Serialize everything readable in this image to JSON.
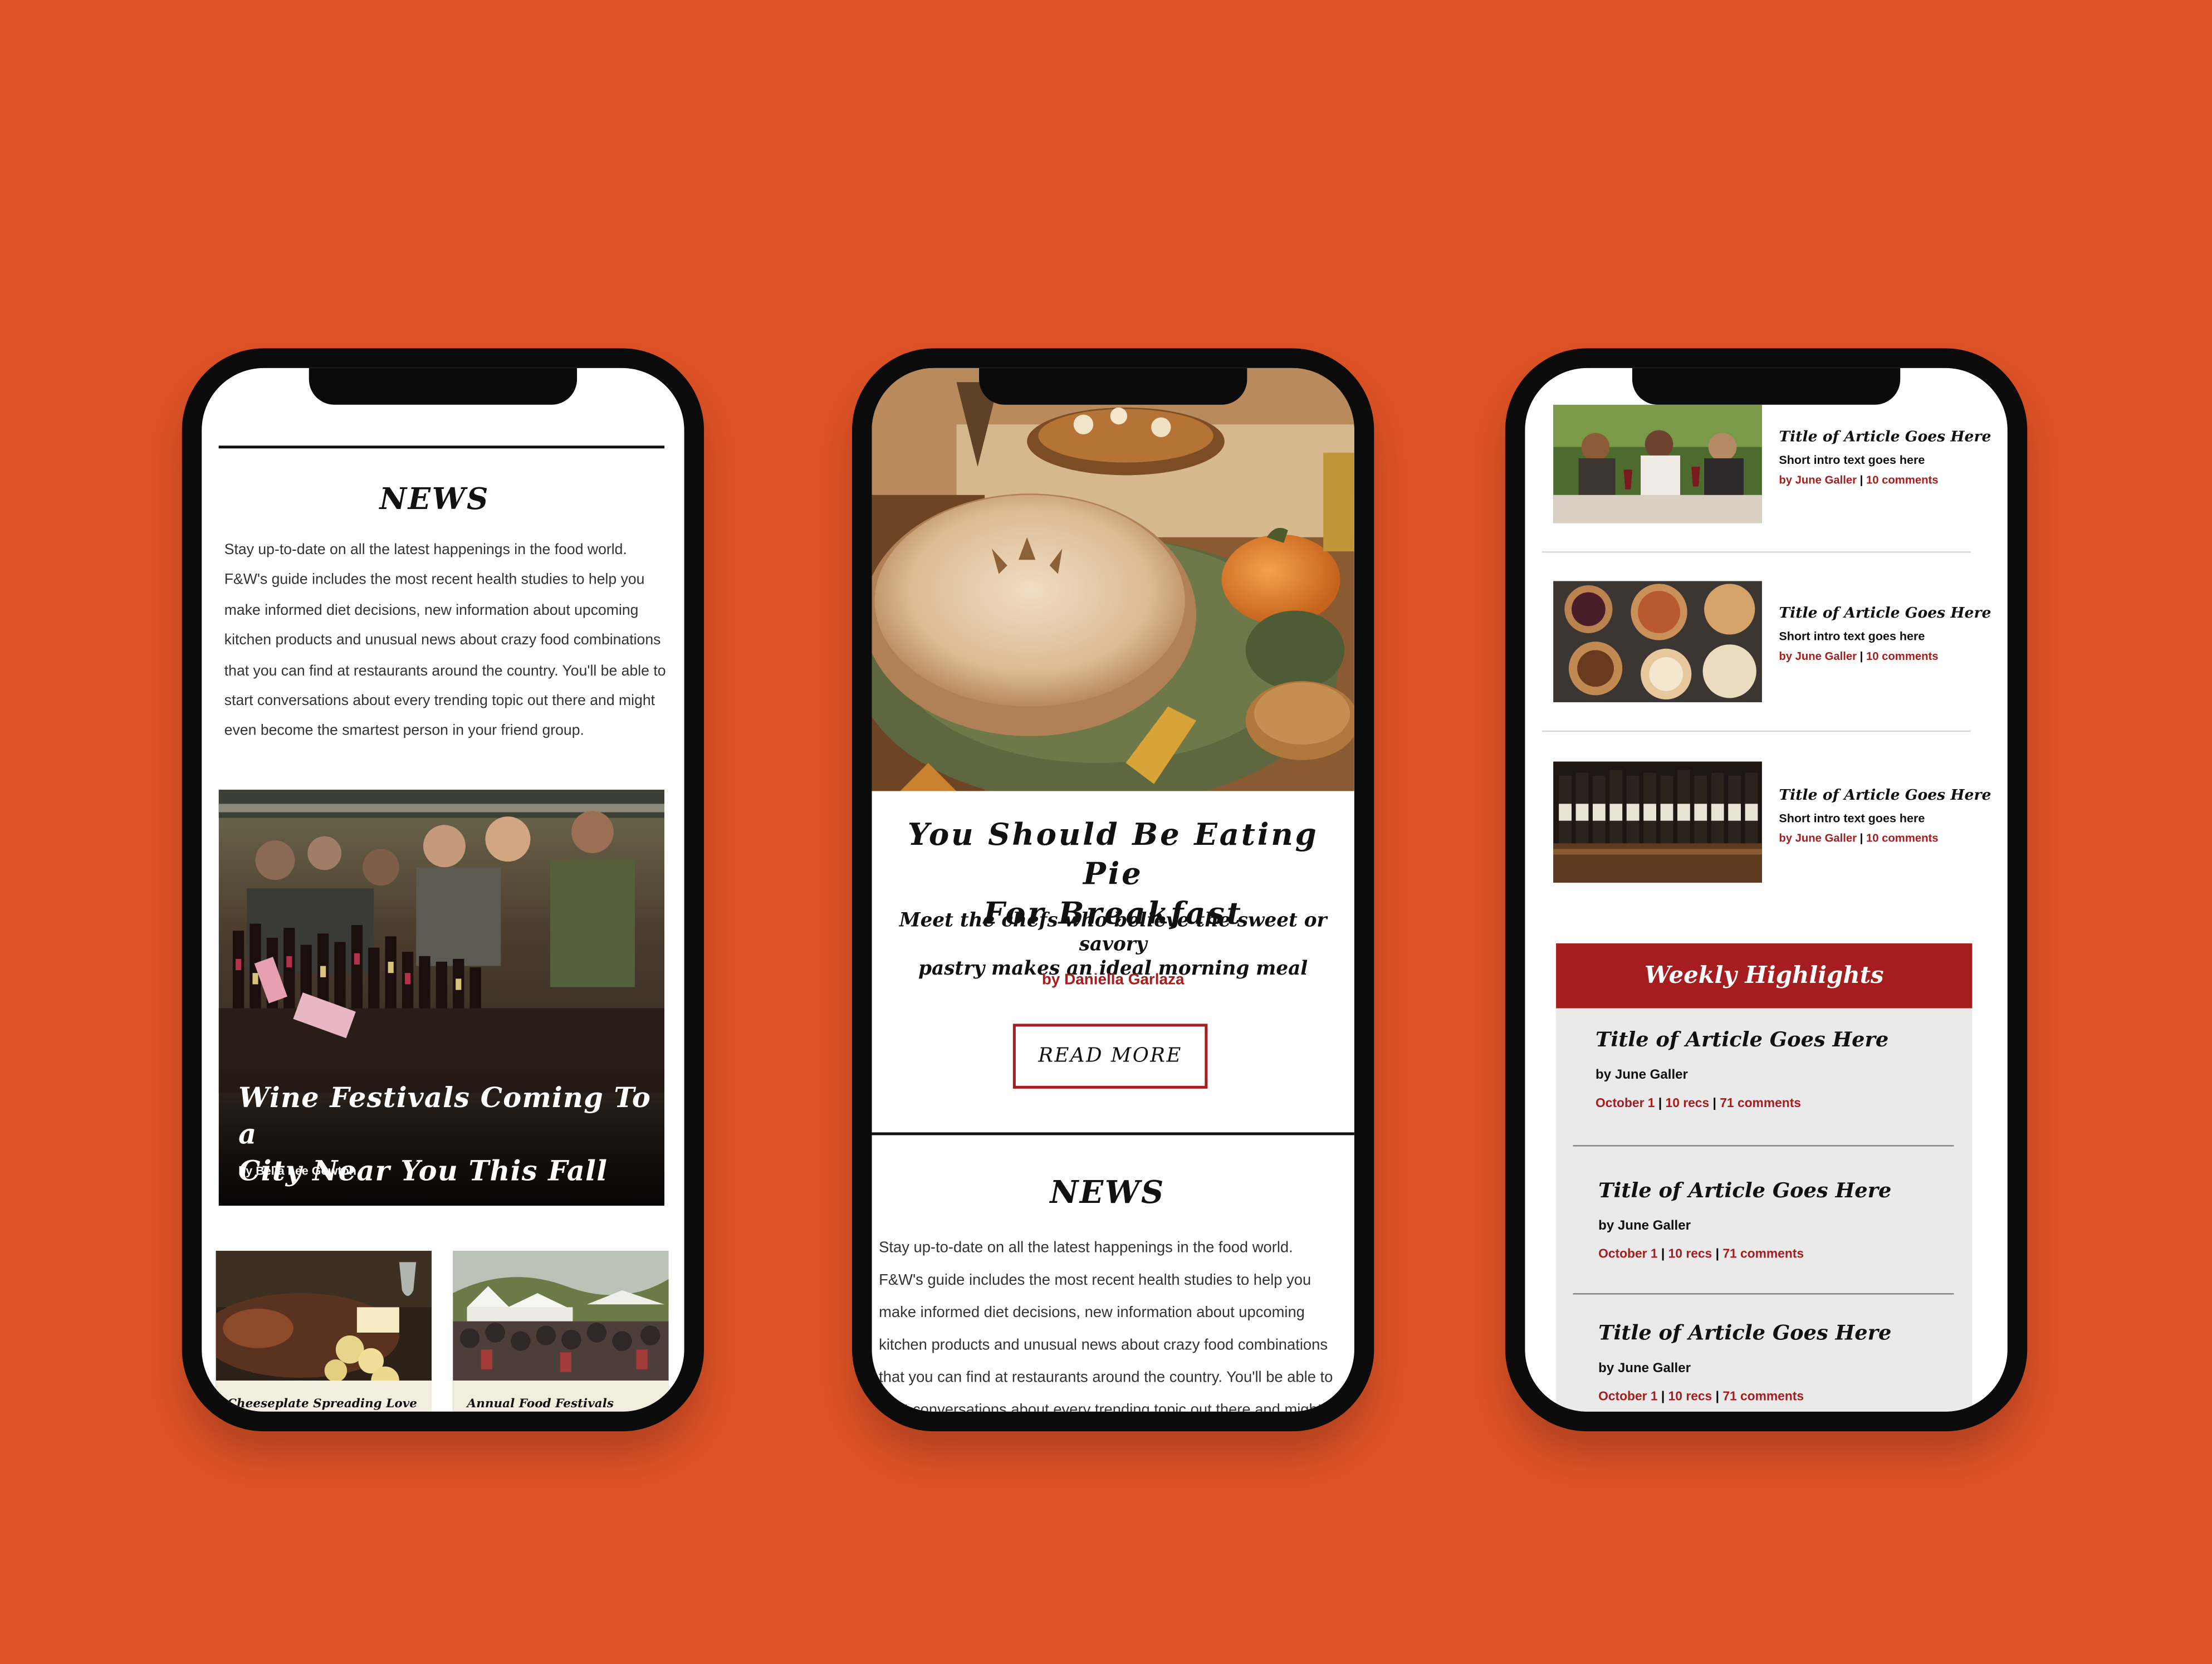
{
  "colors": {
    "background": "#de5227",
    "accent_red": "#a61d1f",
    "phone_frame": "#0b0b0b"
  },
  "phone1": {
    "section_title": "NEWS",
    "intro_lines": [
      "Stay up-to-date on all the latest happenings in the food world.",
      "F&W's guide includes the most recent health studies to help you",
      "make informed diet decisions, new information about upcoming",
      "kitchen products and unusual news about crazy food combinations",
      "that you can find at restaurants around the country. You'll be able to",
      "start conversations about every trending topic out there and might",
      "even become the smartest person in your friend group."
    ],
    "feature": {
      "title_line1": "Wine Festivals Coming To a",
      "title_line2": "City Near You This Fall",
      "byline": "by Bella  Lee Gowton"
    },
    "cards": [
      {
        "caption": "Cheeseplate Spreading Love"
      },
      {
        "caption": "Annual Food Festivals"
      }
    ]
  },
  "phone2": {
    "hero": {
      "title_line1": "You Should Be Eating Pie",
      "title_line2": "For Breakfast",
      "subtitle_line1": "Meet the chefs who believe the sweet or savory",
      "subtitle_line2": "pastry makes an ideal morning meal",
      "byline": "by Daniella Garlaza",
      "button_label": "READ  MORE"
    },
    "section_title": "NEWS",
    "intro_lines": [
      "Stay up-to-date on all the latest happenings in the food world.",
      "F&W's guide includes the most recent health studies to help you",
      "make informed diet decisions, new information about upcoming",
      "kitchen products and unusual news about crazy food combinations",
      "that you can find at restaurants around the country. You'll be able to",
      "start conversations about every trending topic out there and might"
    ]
  },
  "phone3": {
    "articles": [
      {
        "title": "Title of Article Goes Here",
        "intro": "Short intro text goes here",
        "author": "by June Galler",
        "separator": " | ",
        "comments": "10 comments"
      },
      {
        "title": "Title of Article Goes Here",
        "intro": "Short intro text goes here",
        "author": "by June Galler",
        "separator": " | ",
        "comments": "10 comments"
      },
      {
        "title": "Title of Article Goes Here",
        "intro": "Short intro text goes here",
        "author": "by June Galler",
        "separator": " | ",
        "comments": "10 comments"
      }
    ],
    "weekly": {
      "heading": "Weekly Highlights",
      "items": [
        {
          "title": "Title of Article Goes Here",
          "author": "by June Galler",
          "date": "October 1",
          "recs": "10 recs",
          "comments": "71 comments",
          "sep": " | "
        },
        {
          "title": "Title of Article Goes Here",
          "author": "by June Galler",
          "date": "October 1",
          "recs": "10 recs",
          "comments": "71 comments",
          "sep": " | "
        },
        {
          "title": "Title of Article Goes Here",
          "author": "by June Galler",
          "date": "October 1",
          "recs": "10 recs",
          "comments": "71 comments",
          "sep": " | "
        }
      ]
    }
  }
}
